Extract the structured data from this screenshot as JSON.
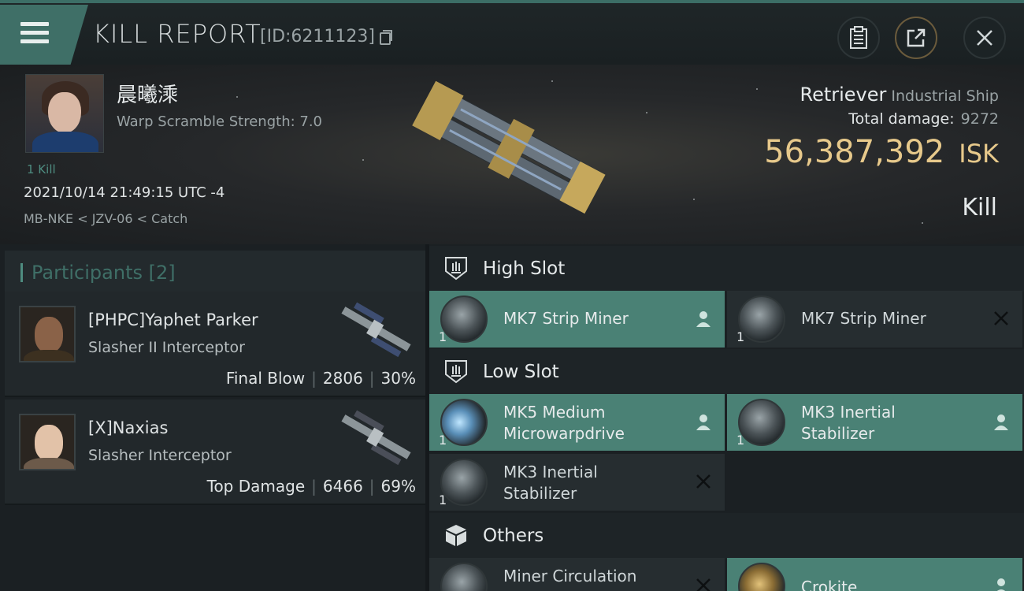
{
  "header": {
    "title": "KILL REPORT",
    "report_id": "[ID:6211123]",
    "clipboard_icon": "clipboard-icon",
    "share_icon": "share-icon",
    "close_icon": "close-icon"
  },
  "victim": {
    "name": "晨曦溗",
    "warp_scramble": "Warp Scramble Strength: 7.0",
    "kill_count": "1 Kill",
    "datetime": "2021/10/14 21:49:15 UTC -4",
    "location": "MB-NKE < JZV-06 < Catch",
    "ship_name": "Retriever",
    "ship_class": "Industrial Ship",
    "total_damage_label": "Total damage:",
    "total_damage": "9272",
    "isk_value": "56,387,392",
    "isk_unit": "ISK",
    "result": "Kill"
  },
  "participants": {
    "header": "Participants [2]",
    "list": [
      {
        "name": "[PHPC]Yaphet Parker",
        "ship": "Slasher II Interceptor",
        "role": "Final Blow",
        "damage": "2806",
        "percent": "30%"
      },
      {
        "name": "[X]Naxias",
        "ship": "Slasher Interceptor",
        "role": "Top Damage",
        "damage": "6466",
        "percent": "69%"
      }
    ]
  },
  "slots": {
    "high": {
      "label": "High Slot",
      "items": [
        {
          "name": "MK7 Strip Miner",
          "qty": "1",
          "status": "pilot-icon"
        },
        {
          "name": "MK7 Strip Miner",
          "qty": "1",
          "status": "destroyed-icon"
        }
      ]
    },
    "low": {
      "label": "Low Slot",
      "items": [
        {
          "name_line1": "MK5 Medium",
          "name_line2": "Microwarpdrive",
          "qty": "1",
          "status": "pilot-icon"
        },
        {
          "name_line1": "MK3 Inertial",
          "name_line2": "Stabilizer",
          "qty": "1",
          "status": "pilot-icon"
        },
        {
          "name_line1": "MK3 Inertial",
          "name_line2": "Stabilizer",
          "qty": "1",
          "status": "destroyed-icon"
        }
      ]
    },
    "others": {
      "label": "Others",
      "items": [
        {
          "name": "Miner Circulation",
          "status": "destroyed-icon"
        },
        {
          "name": "Crokite",
          "status": "pilot-icon"
        }
      ]
    }
  },
  "colors": {
    "accent": "#4a8175",
    "isk": "#e7c98b",
    "header_tab": "#3f6f67"
  }
}
